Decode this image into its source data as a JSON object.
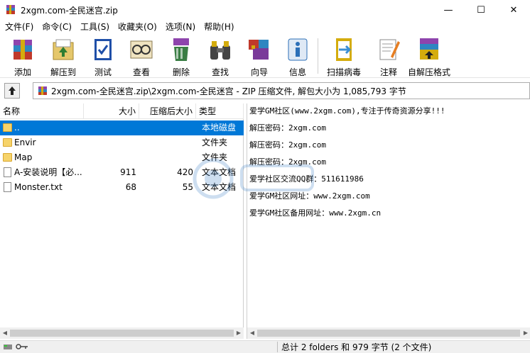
{
  "window": {
    "title": "2xgm.com-全民迷宫.zip",
    "minimize": "—",
    "maximize": "☐",
    "close": "✕"
  },
  "menu": [
    "文件(F)",
    "命令(C)",
    "工具(S)",
    "收藏夹(O)",
    "选项(N)",
    "帮助(H)"
  ],
  "toolbar": [
    {
      "label": "添加",
      "icon": "add-archive-icon",
      "color": "#c0392b"
    },
    {
      "label": "解压到",
      "icon": "extract-to-icon",
      "color": "#c9a227"
    },
    {
      "label": "测试",
      "icon": "test-icon",
      "color": "#1f4fa8"
    },
    {
      "label": "查看",
      "icon": "view-icon",
      "color": "#d9c9a0"
    },
    {
      "label": "删除",
      "icon": "delete-icon",
      "color": "#3a7d44"
    },
    {
      "label": "查找",
      "icon": "find-icon",
      "color": "#555555"
    },
    {
      "label": "向导",
      "icon": "wizard-icon",
      "color": "#7a3a9a"
    },
    {
      "label": "信息",
      "icon": "info-icon",
      "color": "#2c6fb7"
    },
    {
      "label": "扫描病毒",
      "icon": "scan-virus-icon",
      "color": "#3b8fd6"
    },
    {
      "label": "注释",
      "icon": "comment-icon",
      "color": "#e8e8e8"
    },
    {
      "label": "自解压格式",
      "icon": "sfx-icon",
      "color": "#c0392b"
    }
  ],
  "address": {
    "path": "2xgm.com-全民迷宫.zip\\2xgm.com-全民迷宫 - ZIP 压缩文件, 解包大小为 1,085,793 字节"
  },
  "columns": {
    "name": "名称",
    "size": "大小",
    "packed": "压缩后大小",
    "type": "类型"
  },
  "files": [
    {
      "name": "..",
      "size": "",
      "packed": "",
      "type": "本地磁盘",
      "kind": "folder",
      "selected": true
    },
    {
      "name": "Envir",
      "size": "",
      "packed": "",
      "type": "文件夹",
      "kind": "folder",
      "selected": false
    },
    {
      "name": "Map",
      "size": "",
      "packed": "",
      "type": "文件夹",
      "kind": "folder",
      "selected": false
    },
    {
      "name": "A-安装说明【必...",
      "size": "911",
      "packed": "420",
      "type": "文本文档",
      "kind": "file",
      "selected": false
    },
    {
      "name": "Monster.txt",
      "size": "68",
      "packed": "55",
      "type": "文本文档",
      "kind": "file",
      "selected": false
    }
  ],
  "preview_lines": [
    "爱学GM社区(www.2xgm.com),专注于传奇资源分享!!!",
    "解压密码：2xgm.com",
    "解压密码：2xgm.com",
    "解压密码：2xgm.com",
    "爱学社区交流QQ群：511611986",
    "爱学GM社区网址：www.2xgm.com",
    "爱学GM社区备用网址：www.2xgm.cn"
  ],
  "status": {
    "text": "总计 2 folders 和 979 字节 (2 个文件)"
  },
  "colors": {
    "selection": "#0078d7",
    "accent": "#1f4fa8"
  }
}
